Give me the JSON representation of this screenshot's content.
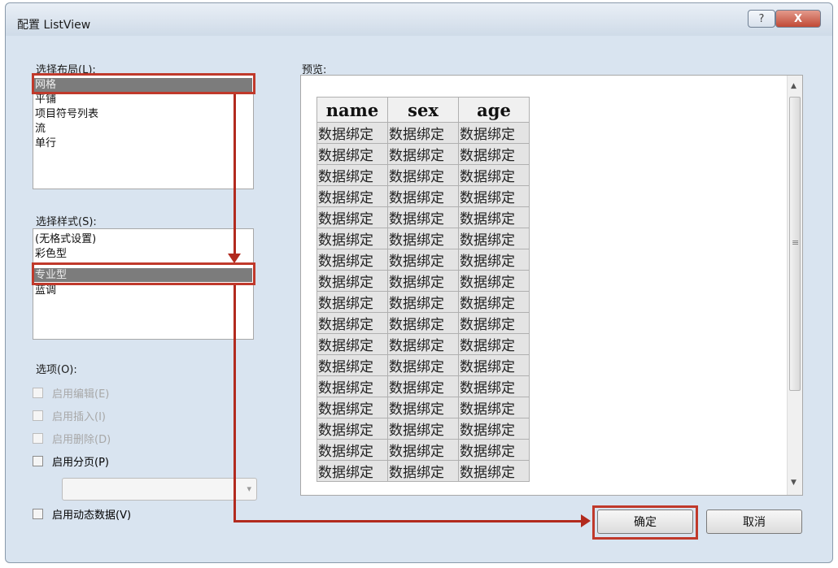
{
  "window": {
    "title": "配置 ListView",
    "help_glyph": "?",
    "close_glyph": "X"
  },
  "layout_section": {
    "label": "选择布局(L):",
    "items": [
      "网格",
      "平铺",
      "项目符号列表",
      "流",
      "单行"
    ],
    "selected": "网格"
  },
  "style_section": {
    "label": "选择样式(S):",
    "items": [
      "(无格式设置)",
      "彩色型",
      "专业型",
      "蓝调"
    ],
    "selected": "专业型"
  },
  "options_section": {
    "label": "选项(O):",
    "checkboxes": [
      {
        "label": "启用编辑(E)",
        "checked": false,
        "enabled": false
      },
      {
        "label": "启用插入(I)",
        "checked": false,
        "enabled": false
      },
      {
        "label": "启用删除(D)",
        "checked": false,
        "enabled": false
      },
      {
        "label": "启用分页(P)",
        "checked": false,
        "enabled": true
      }
    ],
    "paging_combo_value": "",
    "dynamic_data": {
      "label": "启用动态数据(V)",
      "checked": false,
      "enabled": true
    }
  },
  "preview_section": {
    "label": "预览:",
    "columns": [
      "name",
      "sex",
      "age"
    ],
    "cell_text": "数据绑定",
    "row_count": 17
  },
  "buttons": {
    "ok": "确定",
    "cancel": "取消"
  },
  "colors": {
    "highlight_border": "#c0392b",
    "selected_item_bg": "#7c7c7c",
    "arrow_color": "#b22a1e"
  },
  "icons": {
    "scroll_up": "▲",
    "scroll_down": "▼",
    "scroll_grip": "≡",
    "combo_arrow": "▾"
  }
}
